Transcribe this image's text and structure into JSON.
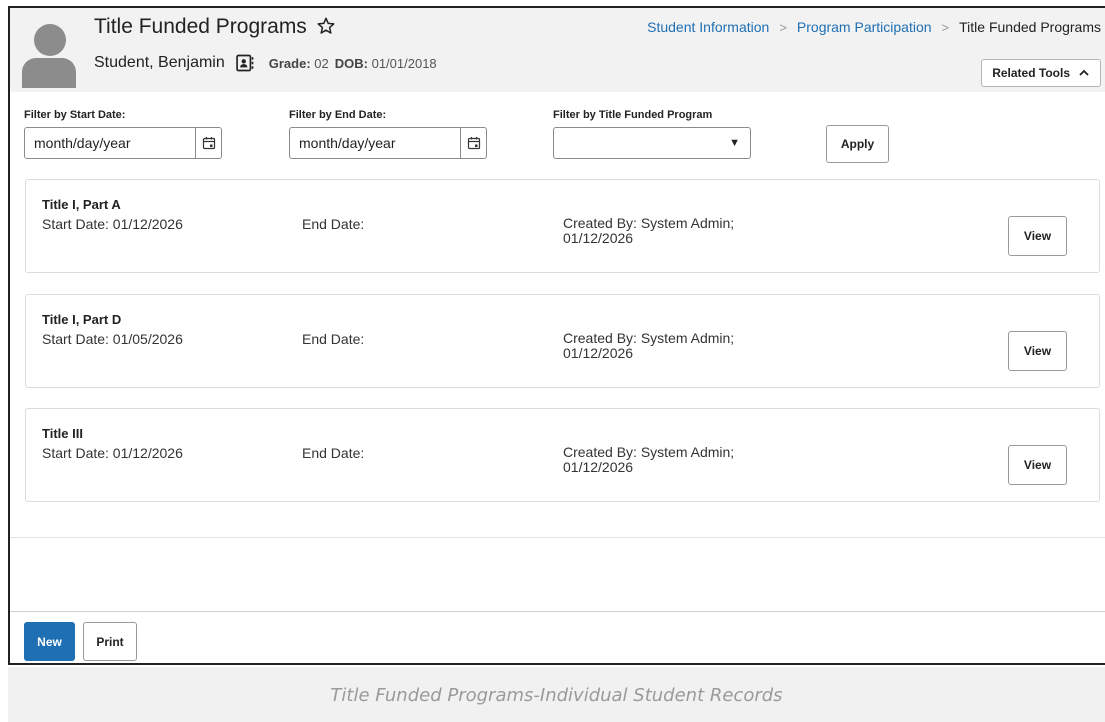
{
  "header": {
    "page_title": "Title Funded Programs",
    "student_name": "Student, Benjamin",
    "grade_label": "Grade:",
    "grade_value": "02",
    "dob_label": "DOB:",
    "dob_value": "01/01/2018",
    "related_tools_label": "Related Tools"
  },
  "breadcrumb": {
    "items": [
      "Student Information",
      "Program Participation",
      "Title Funded Programs"
    ],
    "separator": ">"
  },
  "filters": {
    "start_label": "Filter by Start Date:",
    "start_value": "month/day/year",
    "end_label": "Filter by End Date:",
    "end_value": "month/day/year",
    "program_label": "Filter by Title Funded Program",
    "program_value": "",
    "apply_label": "Apply"
  },
  "programs": [
    {
      "title": "Title I, Part A",
      "start": "Start Date: 01/12/2026",
      "end": "End Date:",
      "created_line1": "Created By: System Admin;",
      "created_line2": "01/12/2026",
      "view_label": "View"
    },
    {
      "title": "Title I, Part D",
      "start": "Start Date: 01/05/2026",
      "end": "End Date:",
      "created_line1": "Created By: System Admin;",
      "created_line2": "01/12/2026",
      "view_label": "View"
    },
    {
      "title": "Title III",
      "start": "Start Date: 01/12/2026",
      "end": "End Date:",
      "created_line1": "Created By: System Admin;",
      "created_line2": "01/12/2026",
      "view_label": "View"
    }
  ],
  "footer": {
    "new_label": "New",
    "print_label": "Print"
  },
  "caption": "Title Funded Programs-Individual Student Records",
  "colors": {
    "accent": "#1f6fb5",
    "header_bg": "#f2f2f2",
    "avatar": "#8c8c8c"
  },
  "icons": {
    "star": "star-outline-icon",
    "contact": "contact-card-icon",
    "calendar": "calendar-icon",
    "chevron": "chevron-up-icon",
    "dropdown": "dropdown-caret-icon"
  }
}
